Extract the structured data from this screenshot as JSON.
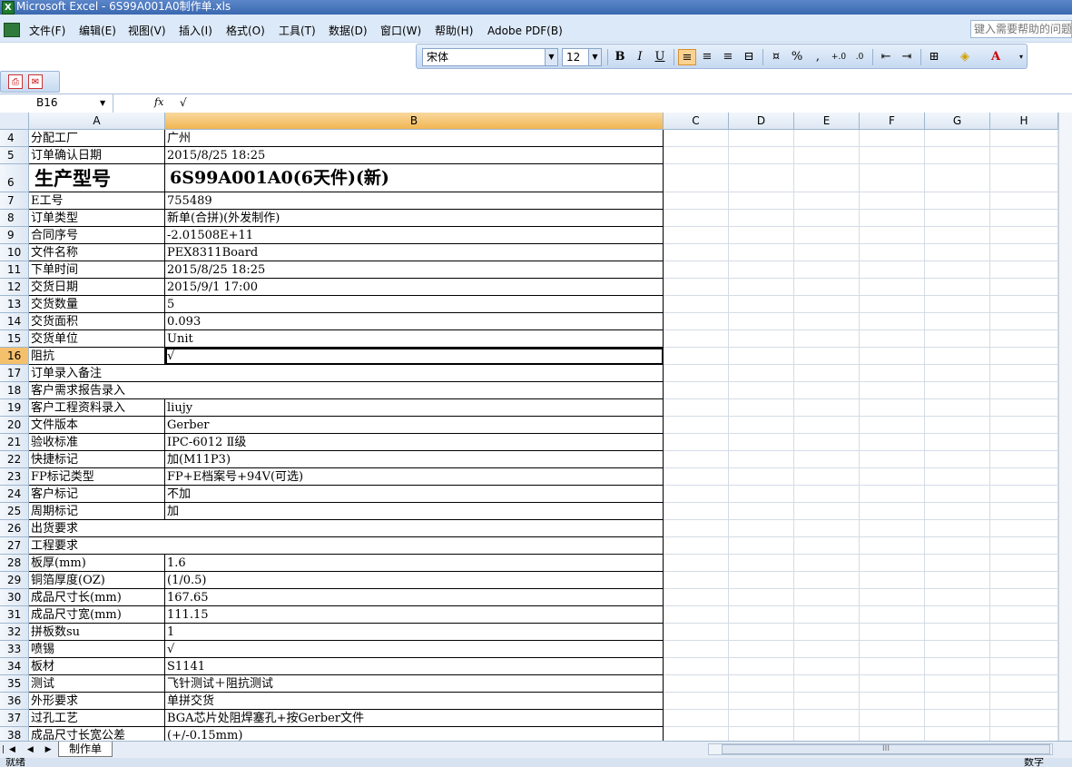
{
  "window": {
    "title": "Microsoft Excel - 6S99A001A0制作单.xls"
  },
  "menu": [
    "文件(F)",
    "编辑(E)",
    "视图(V)",
    "插入(I)",
    "格式(O)",
    "工具(T)",
    "数据(D)",
    "窗口(W)",
    "帮助(H)",
    "Adobe PDF(B)"
  ],
  "help_placeholder": "键入需要帮助的问题",
  "format_toolbar": {
    "font": "宋体",
    "size": "12",
    "bold": "B",
    "italic": "I",
    "underline": "U",
    "percent": "%",
    "comma": ","
  },
  "formula_bar": {
    "cell_ref": "B16",
    "fx": "fx",
    "value": "√"
  },
  "columns": [
    "A",
    "B",
    "C",
    "D",
    "E",
    "F",
    "G",
    "H"
  ],
  "selected": {
    "column": "B",
    "row": "16"
  },
  "rows": [
    {
      "n": "4",
      "a": "分配工厂",
      "b": "广州"
    },
    {
      "n": "5",
      "a": "订单确认日期",
      "b": "2015/8/25 18:25"
    },
    {
      "n": "6",
      "a": "生产型号",
      "b": "6S99A001A0(6天件)(新)",
      "big": true
    },
    {
      "n": "7",
      "a": "E工号",
      "b": "755489"
    },
    {
      "n": "8",
      "a": "订单类型",
      "b": "新单(合拼)(外发制作)"
    },
    {
      "n": "9",
      "a": "合同序号",
      "b": "-2.01508E+11"
    },
    {
      "n": "10",
      "a": "文件名称",
      "b": "PEX8311Board"
    },
    {
      "n": "11",
      "a": "下单时间",
      "b": "2015/8/25 18:25"
    },
    {
      "n": "12",
      "a": "交货日期",
      "b": "2015/9/1 17:00"
    },
    {
      "n": "13",
      "a": "交货数量",
      "b": "5"
    },
    {
      "n": "14",
      "a": "交货面积",
      "b": "0.093"
    },
    {
      "n": "15",
      "a": "交货单位",
      "b": "Unit"
    },
    {
      "n": "16",
      "a": "阻抗",
      "b": "√"
    },
    {
      "n": "17",
      "a": "订单录入备注",
      "b": "",
      "merged": true
    },
    {
      "n": "18",
      "a": "客户需求报告录入",
      "b": "",
      "merged": true
    },
    {
      "n": "19",
      "a": "客户工程资料录入",
      "b": "liujy"
    },
    {
      "n": "20",
      "a": "文件版本",
      "b": "Gerber"
    },
    {
      "n": "21",
      "a": "验收标准",
      "b": "IPC-6012 Ⅱ级"
    },
    {
      "n": "22",
      "a": "快捷标记",
      "b": "加(M11P3)"
    },
    {
      "n": "23",
      "a": "FP标记类型",
      "b": "FP+E档案号+94V(可选)"
    },
    {
      "n": "24",
      "a": "客户标记",
      "b": "不加"
    },
    {
      "n": "25",
      "a": "周期标记",
      "b": "加"
    },
    {
      "n": "26",
      "a": "出货要求",
      "b": "",
      "merged": true
    },
    {
      "n": "27",
      "a": "工程要求",
      "b": "",
      "merged": true
    },
    {
      "n": "28",
      "a": "板厚(mm)",
      "b": "1.6"
    },
    {
      "n": "29",
      "a": "铜箔厚度(OZ)",
      "b": " (1/0.5)"
    },
    {
      "n": "30",
      "a": "成品尺寸长(mm)",
      "b": "167.65"
    },
    {
      "n": "31",
      "a": "成品尺寸宽(mm)",
      "b": "111.15"
    },
    {
      "n": "32",
      "a": "拼板数su",
      "b": "1"
    },
    {
      "n": "33",
      "a": "喷锡",
      "b": "√"
    },
    {
      "n": "34",
      "a": "板材",
      "b": "S1141"
    },
    {
      "n": "35",
      "a": "测试",
      "b": "飞针测试＋阻抗测试"
    },
    {
      "n": "36",
      "a": "外形要求",
      "b": "单拼交货"
    },
    {
      "n": "37",
      "a": "过孔工艺",
      "b": "BGA芯片处阻焊塞孔+按Gerber文件"
    },
    {
      "n": "38",
      "a": "成品尺寸长宽公差",
      "b": "(+/-0.15mm)"
    }
  ],
  "sheet_tab": "制作单",
  "scroll_grip": "III",
  "status": {
    "left": "就绪",
    "right": "数字"
  }
}
